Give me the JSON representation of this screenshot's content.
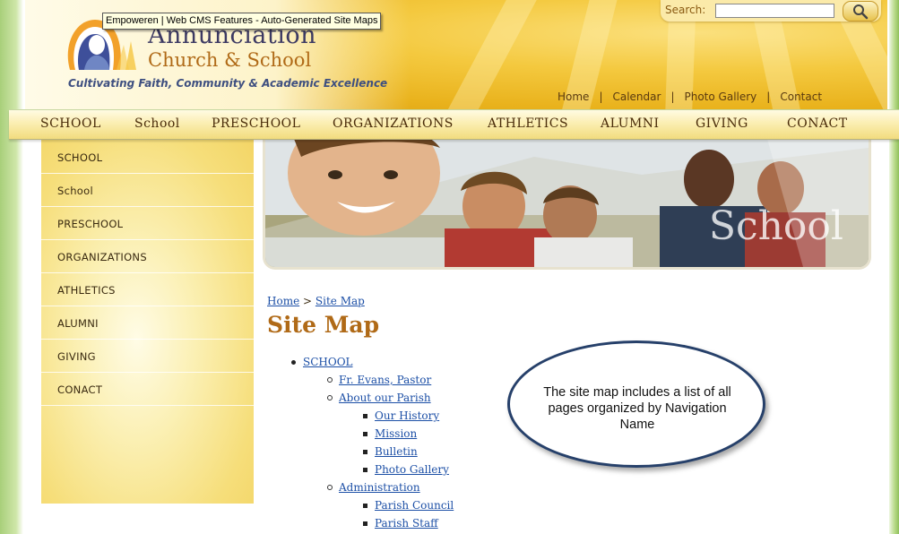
{
  "tooltip": "Empoweren | Web CMS Features - Auto-Generated Site Maps",
  "logo": {
    "title": "Annunciation",
    "subtitle": "Church & School",
    "tagline": "Cultivating Faith, Community & Academic Excellence"
  },
  "search": {
    "label": "Search:",
    "value": ""
  },
  "top_links": [
    "Home",
    "Calendar",
    "Photo Gallery",
    "Contact"
  ],
  "main_nav": [
    "SCHOOL",
    "School",
    "PRESCHOOL",
    "ORGANIZATIONS",
    "ATHLETICS",
    "ALUMNI",
    "GIVING",
    "CONACT"
  ],
  "sidebar": [
    "SCHOOL",
    "School",
    "PRESCHOOL",
    "ORGANIZATIONS",
    "ATHLETICS",
    "ALUMNI",
    "GIVING",
    "CONACT"
  ],
  "banner": {
    "title": "School"
  },
  "breadcrumb": {
    "home": "Home",
    "separator": ">",
    "current": "Site Map"
  },
  "page_title": "Site Map",
  "sitemap": [
    {
      "level": 1,
      "label": "SCHOOL"
    },
    {
      "level": 2,
      "label": "Fr. Evans, Pastor"
    },
    {
      "level": 2,
      "label": "About our Parish"
    },
    {
      "level": 3,
      "label": "Our History"
    },
    {
      "level": 3,
      "label": "Mission"
    },
    {
      "level": 3,
      "label": "Bulletin"
    },
    {
      "level": 3,
      "label": "Photo Gallery"
    },
    {
      "level": 2,
      "label": "Administration"
    },
    {
      "level": 3,
      "label": "Parish Council"
    },
    {
      "level": 3,
      "label": "Parish Staff"
    }
  ],
  "callout": "The site map includes a list of all pages organized by Navigation Name",
  "colors": {
    "accent": "#b06a17",
    "link": "#1c4fa6",
    "navy": "#3d3a63"
  }
}
